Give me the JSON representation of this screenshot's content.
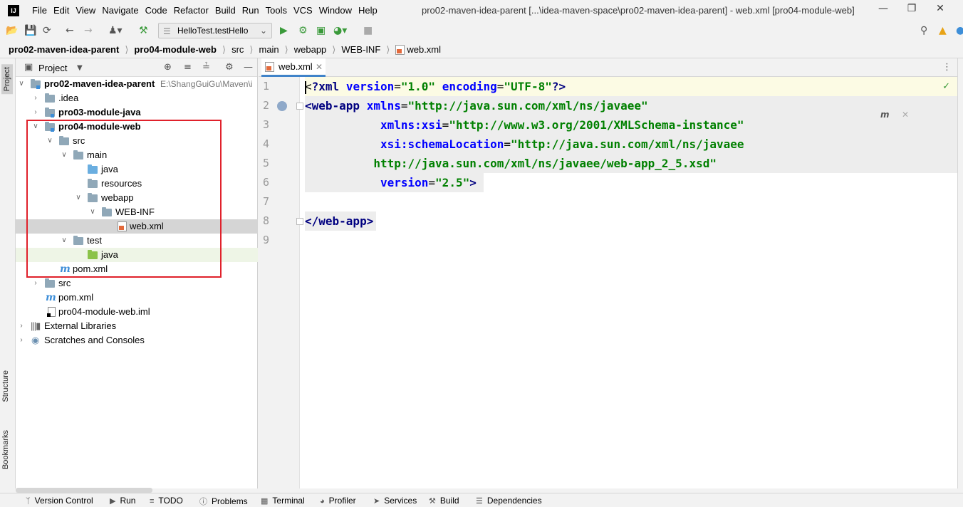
{
  "app": {
    "logo": "IJ",
    "menu": [
      "File",
      "Edit",
      "View",
      "Navigate",
      "Code",
      "Refactor",
      "Build",
      "Run",
      "Tools",
      "VCS",
      "Window",
      "Help"
    ],
    "window_title": "pro02-maven-idea-parent [...\\idea-maven-space\\pro02-maven-idea-parent] - web.xml [pro04-module-web]"
  },
  "toolbar": {
    "run_config": "HelloTest.testHello"
  },
  "breadcrumbs": [
    "pro02-maven-idea-parent",
    "pro04-module-web",
    "src",
    "main",
    "webapp",
    "WEB-INF",
    "web.xml"
  ],
  "left_stripe": {
    "project_tab": "Project",
    "structure_tab": "Structure",
    "bookmarks_tab": "Bookmarks"
  },
  "project_panel": {
    "title": "Project",
    "tree": [
      {
        "label": "pro02-maven-idea-parent",
        "path": "E:\\ShangGuiGu\\Maven\\i",
        "bold": true
      },
      {
        "label": ".idea"
      },
      {
        "label": "pro03-module-java",
        "bold": true
      },
      {
        "label": "pro04-module-web",
        "bold": true
      },
      {
        "label": "src"
      },
      {
        "label": "main"
      },
      {
        "label": "java"
      },
      {
        "label": "resources"
      },
      {
        "label": "webapp"
      },
      {
        "label": "WEB-INF"
      },
      {
        "label": "web.xml"
      },
      {
        "label": "test"
      },
      {
        "label": "java"
      },
      {
        "label": "pom.xml"
      },
      {
        "label": "src"
      },
      {
        "label": "pom.xml"
      },
      {
        "label": "pro04-module-web.iml"
      },
      {
        "label": "External Libraries"
      },
      {
        "label": "Scratches and Consoles"
      }
    ]
  },
  "editor": {
    "tab": "web.xml",
    "line_numbers": [
      "1",
      "2",
      "3",
      "4",
      "5",
      "6",
      "7",
      "8",
      "9"
    ],
    "lines": [
      {
        "t1": "?xml ",
        "a1": "version",
        "e1": "=",
        "v1": "\"1.0\"",
        "s1": " ",
        "a2": "encoding",
        "e2": "=",
        "v2": "\"UTF-8\"",
        "end": "?>"
      },
      {
        "open": "<web-app ",
        "a1": "xmlns",
        "e1": "=",
        "v1": "\"http://java.sun.com/xml/ns/javaee\""
      },
      {
        "indent": "           ",
        "a1": "xmlns:xsi",
        "e1": "=",
        "v1": "\"http://www.w3.org/2001/XMLSchema-instance\""
      },
      {
        "indent": "           ",
        "a1": "xsi:schemaLocation",
        "e1": "=",
        "v1": "\"http://java.sun.com/xml/ns/javaee"
      },
      {
        "indent": "          ",
        "v1": "http://java.sun.com/xml/ns/javaee/web-app_2_5.xsd\""
      },
      {
        "indent": "           ",
        "a1": "version",
        "e1": "=",
        "v1": "\"2.5\"",
        "end": ">"
      },
      {},
      {
        "close": "</web-app>"
      },
      {}
    ],
    "maven_badge": "m"
  },
  "bottom_tabs": [
    "Version Control",
    "Run",
    "TODO",
    "Problems",
    "Terminal",
    "Profiler",
    "Services",
    "Build",
    "Dependencies"
  ]
}
